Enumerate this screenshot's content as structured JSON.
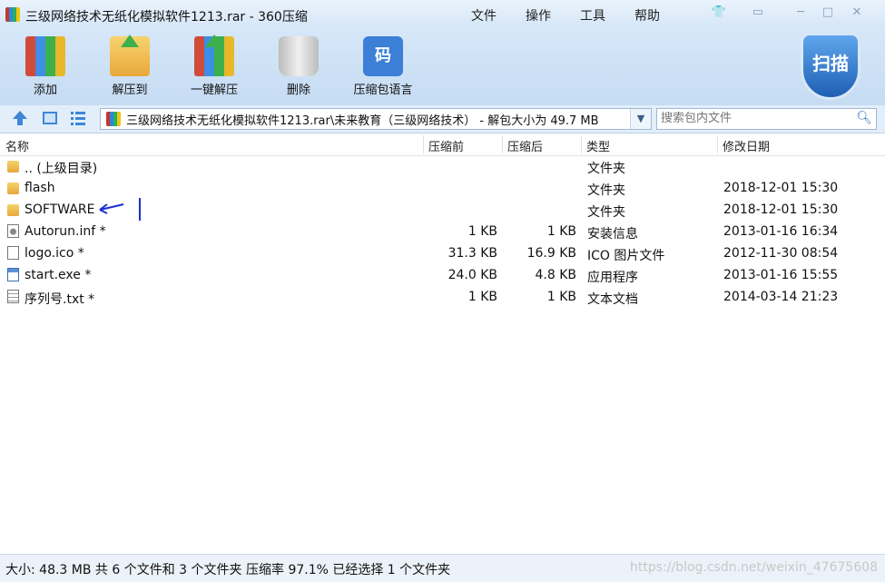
{
  "window": {
    "title": "三级网络技术无纸化模拟软件1213.rar - 360压缩",
    "menu": [
      "文件",
      "操作",
      "工具",
      "帮助"
    ]
  },
  "toolbar": {
    "buttons": [
      {
        "label": "添加",
        "icon": "add-icon"
      },
      {
        "label": "解压到",
        "icon": "extract-to-icon"
      },
      {
        "label": "一键解压",
        "icon": "one-click-extract-icon"
      },
      {
        "label": "删除",
        "icon": "delete-icon"
      },
      {
        "label": "压缩包语言",
        "icon": "archive-language-icon",
        "glyph": "码"
      }
    ],
    "scan_label": "扫描"
  },
  "address": {
    "path": "三级网络技术无纸化模拟软件1213.rar\\未来教育（三级网络技术）  - 解包大小为 49.7 MB"
  },
  "search": {
    "placeholder": "搜索包内文件"
  },
  "columns": [
    "名称",
    "压缩前",
    "压缩后",
    "类型",
    "修改日期"
  ],
  "files": [
    {
      "name": ".. (上级目录)",
      "before": "",
      "after": "",
      "type": "文件夹",
      "date": "",
      "icon": "folder-icon"
    },
    {
      "name": "flash",
      "before": "",
      "after": "",
      "type": "文件夹",
      "date": "2018-12-01 15:30",
      "icon": "folder-icon"
    },
    {
      "name": "SOFTWARE",
      "before": "",
      "after": "",
      "type": "文件夹",
      "date": "2018-12-01 15:30",
      "icon": "folder-icon"
    },
    {
      "name": "Autorun.inf *",
      "before": "1 KB",
      "after": "1 KB",
      "type": "安装信息",
      "date": "2013-01-16 16:34",
      "icon": "settings-file-icon"
    },
    {
      "name": "logo.ico *",
      "before": "31.3 KB",
      "after": "16.9 KB",
      "type": "ICO 图片文件",
      "date": "2012-11-30 08:54",
      "icon": "file-icon"
    },
    {
      "name": "start.exe *",
      "before": "24.0 KB",
      "after": "4.8 KB",
      "type": "应用程序",
      "date": "2013-01-16 15:55",
      "icon": "exe-icon"
    },
    {
      "name": "序列号.txt *",
      "before": "1 KB",
      "after": "1 KB",
      "type": "文本文档",
      "date": "2014-03-14 21:23",
      "icon": "text-file-icon"
    }
  ],
  "status": "大小: 48.3 MB 共 6 个文件和 3 个文件夹 压缩率 97.1% 已经选择 1 个文件夹",
  "watermark": "https://blog.csdn.net/weixin_47675608",
  "colors": {
    "annotation": "#1a2fd0",
    "toolbar": "#c6dcf3"
  }
}
